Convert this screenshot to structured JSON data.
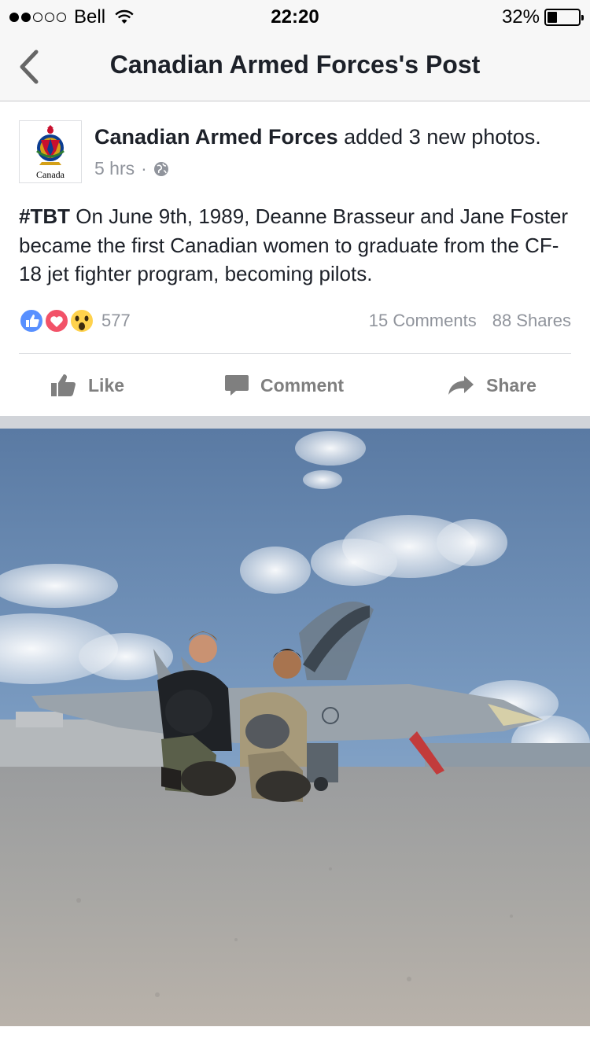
{
  "status_bar": {
    "carrier": "Bell",
    "time": "22:20",
    "battery_percent_label": "32%",
    "battery_level": 0.32
  },
  "nav": {
    "title": "Canadian Armed Forces's Post",
    "back_icon": "chevron-left-icon"
  },
  "post": {
    "author": "Canadian Armed Forces",
    "action_text": "added 3 new photos.",
    "time_ago": "5 hrs",
    "separator": "·",
    "privacy_icon": "globe-icon",
    "avatar_wordmark": "Canada",
    "hashtag": "#TBT",
    "body": "On June 9th, 1989, Deanne Brasseur and Jane Foster became the first Canadian women to graduate from the CF-18 jet fighter program, becoming pilots.",
    "reactions": [
      "like",
      "love",
      "wow"
    ],
    "reaction_count": "577",
    "comments_count": "15 Comments",
    "shares_count": "88 Shares"
  },
  "actions": {
    "like": "Like",
    "comment": "Comment",
    "share": "Share"
  },
  "colors": {
    "fb_blue": "#5890ff",
    "love_red": "#f25268",
    "wow_yellow": "#ffd24d",
    "text_dark": "#1d2129",
    "text_gray": "#90949c"
  }
}
